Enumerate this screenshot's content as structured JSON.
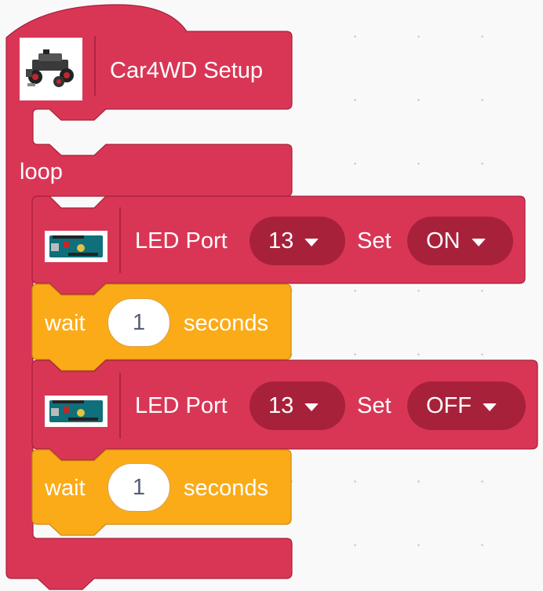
{
  "colors": {
    "event_block": "#d93656",
    "event_stroke": "#a8213a",
    "control_block": "#fbab18",
    "control_stroke": "#cc8b13",
    "canvas": "#f9f9f9"
  },
  "setup_block": {
    "image_icon": "car4wd-robot-icon",
    "label": "Car4WD Setup"
  },
  "loop_block": {
    "label": "loop"
  },
  "statements": [
    {
      "type": "led",
      "image_icon": "arduino-board-icon",
      "label": "LED Port",
      "port_value": "13",
      "set_label": "Set",
      "state_value": "ON"
    },
    {
      "type": "wait",
      "label": "wait",
      "value": "1",
      "unit_label": "seconds"
    },
    {
      "type": "led",
      "image_icon": "arduino-board-icon",
      "label": "LED Port",
      "port_value": "13",
      "set_label": "Set",
      "state_value": "OFF"
    },
    {
      "type": "wait",
      "label": "wait",
      "value": "1",
      "unit_label": "seconds"
    }
  ]
}
